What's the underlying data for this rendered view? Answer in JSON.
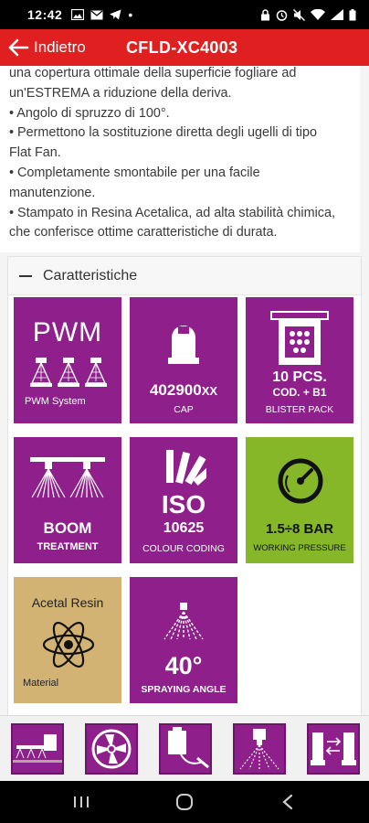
{
  "status_bar": {
    "time": "12:42",
    "dot": "•"
  },
  "app_bar": {
    "back_label": "Indietro",
    "title": "CFLD-XC4003"
  },
  "description": {
    "lines": [
      "una copertura ottimale della superficie fogliare ad",
      "un'ESTREMA a riduzione della deriva.",
      "• Angolo di spruzzo di 100°.",
      "• Permettono la sostituzione diretta degli ugelli di tipo",
      "Flat Fan.",
      "• Completamente smontabile per una facile",
      "manutenzione.",
      "• Stampato in Resina Acetalica, ad alta stabilità chimica,",
      "che conferisce ottime caratteristiche di durata."
    ]
  },
  "features": {
    "title": "Caratteristiche",
    "tiles": [
      {
        "id": "pwm",
        "big": "PWM",
        "caption": "PWM System",
        "color": "#8e1f8b",
        "icon": "nozzle-array-icon"
      },
      {
        "id": "cap",
        "big_main": "402900",
        "big_suffix": "XX",
        "caption": "CAP",
        "color": "#8e1f8b",
        "icon": "cap-icon"
      },
      {
        "id": "blister",
        "big": "10 PCS.",
        "line2": "COD. + B1",
        "caption": "BLISTER PACK",
        "color": "#8e1f8b",
        "icon": "blister-pack-icon"
      },
      {
        "id": "boom",
        "big": "BOOM",
        "caption": "TREATMENT",
        "color": "#8e1f8b",
        "icon": "boom-spray-icon"
      },
      {
        "id": "iso",
        "big": "ISO",
        "line2": "10625",
        "caption": "COLOUR CODING",
        "color": "#8e1f8b",
        "icon": "colour-fan-icon"
      },
      {
        "id": "pressure",
        "big": "1.5÷8 BAR",
        "caption": "WORKING PRESSURE",
        "color": "#86b728",
        "icon": "pressure-gauge-icon"
      },
      {
        "id": "material",
        "title": "Acetal Resin",
        "caption": "Material",
        "color": "#d2b373",
        "icon": "atom-icon"
      },
      {
        "id": "angle",
        "big": "40°",
        "caption": "SPRAYING ANGLE",
        "color": "#8e1f8b",
        "icon": "spray-cone-icon"
      }
    ]
  },
  "bottom_nav": {
    "items": [
      "boom-sprayer-icon",
      "fan-icon",
      "sprayer-tank-icon",
      "nozzle-spray-icon",
      "nozzle-compare-icon"
    ]
  },
  "system_nav": {
    "items": [
      "recents-button",
      "home-button",
      "back-button"
    ]
  }
}
